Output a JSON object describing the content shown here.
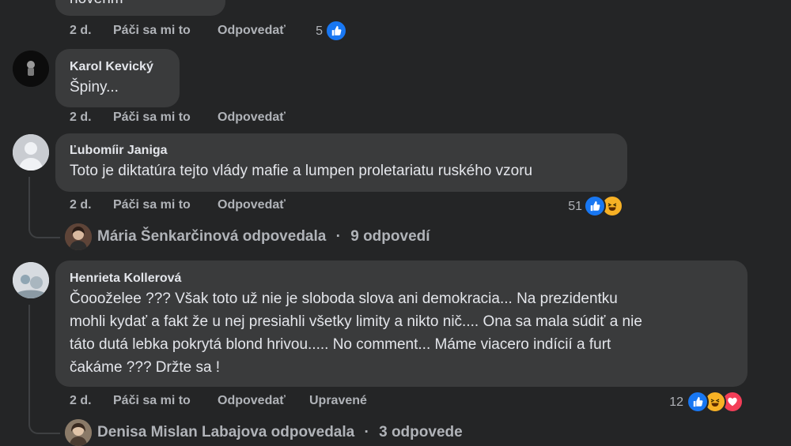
{
  "top_comment": {
    "text_fragment": "novenm",
    "meta": {
      "time": "2 d.",
      "like": "Páči sa mi to",
      "reply": "Odpovedať"
    },
    "reactions_count": "5"
  },
  "comments": [
    {
      "author": "Karol Kevický",
      "text": "Špiny...",
      "meta": {
        "time": "2 d.",
        "like": "Páči sa mi to",
        "reply": "Odpovedať"
      }
    },
    {
      "author": "Ľubomíir Janiga",
      "text": "Toto je diktatúra tejto vlády mafie a lumpen proletariatu ruského vzoru",
      "meta": {
        "time": "2 d.",
        "like": "Páči sa mi to",
        "reply": "Odpovedať"
      },
      "reactions_count": "51",
      "replies": {
        "name": "Mária Šenkarčinová odpovedala",
        "count": "9 odpovedí"
      }
    },
    {
      "author": "Henrieta Kollerová",
      "lines": [
        "Čoooželee ??? Však toto už nie je sloboda slova ani demokracia... Na prezidentku",
        "mohli kydať a fakt že u nej presiahli všetky limity a nikto nič.... Ona sa mala súdiť a nie",
        "táto dutá lebka pokrytá blond hrivou..... No comment... Máme viacero indícií a furt",
        "čakáme ??? Držte sa !"
      ],
      "meta": {
        "time": "2 d.",
        "like": "Páči sa mi to",
        "reply": "Odpovedať",
        "edited": "Upravené"
      },
      "reactions_count": "12",
      "replies": {
        "name": "Denisa Mislan Labajova odpovedala",
        "count": "3 odpovede"
      }
    }
  ],
  "separator": "·",
  "colors": {
    "like": "#1877f2",
    "haha": "#f7b125",
    "love": "#f33e58"
  }
}
